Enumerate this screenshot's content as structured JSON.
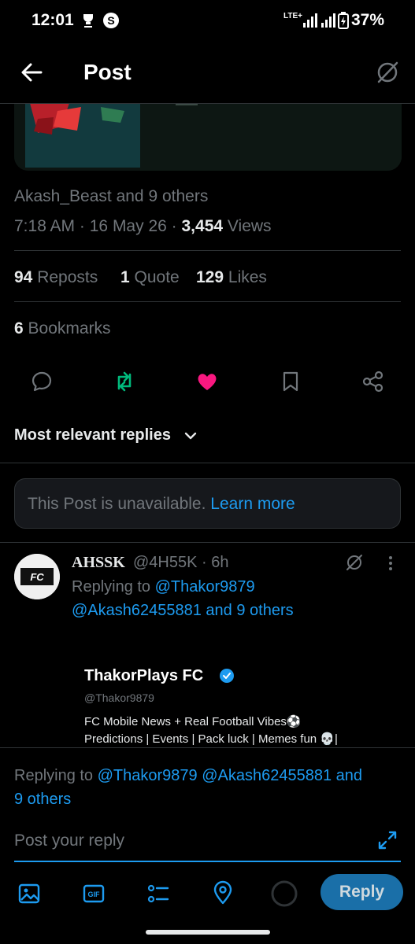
{
  "status_bar": {
    "time": "12:01",
    "network": "LTE+",
    "battery": "37%"
  },
  "header": {
    "title": "Post"
  },
  "post": {
    "likers": "Akash_Beast and 9 others",
    "time": "7:18 AM",
    "sep1": "·",
    "date": "16 May 26",
    "sep2": "·",
    "views_count": "3,454",
    "views_label": "Views",
    "reposts_count": "94",
    "reposts_label": "Reposts",
    "quotes_count": "1",
    "quotes_label": "Quote",
    "likes_count": "129",
    "likes_label": "Likes",
    "bookmarks_count": "6",
    "bookmarks_label": "Bookmarks"
  },
  "replies_sort": {
    "label": "Most relevant replies"
  },
  "unavailable": {
    "text": "This Post is unavailable.",
    "link": "Learn more"
  },
  "reply_tweet": {
    "name": "AHSSK",
    "handle": "@4H55K",
    "dot": "·",
    "age": "6h",
    "replying_label": "Replying to",
    "replying_first": "@Thakor9879",
    "replying_rest": "@Akash62455881 and 9 others",
    "card_name": "ThakorPlays FC",
    "card_handle": "@Thakor9879",
    "card_bio_line1": "FC Mobile News + Real Football Vibes⚽",
    "card_bio_line2": "Predictions | Events | Pack luck | Memes fun 💀|"
  },
  "composer": {
    "replying_label": "Replying to",
    "replying_users": "@Thakor9879 @Akash62455881 and",
    "replying_rest": "9 others",
    "placeholder": "Post your reply",
    "reply_button": "Reply"
  },
  "colors": {
    "background": "#000000",
    "accent": "#1d9bf0",
    "like": "#f91880",
    "repost": "#00ba7c",
    "muted": "#71767b"
  }
}
